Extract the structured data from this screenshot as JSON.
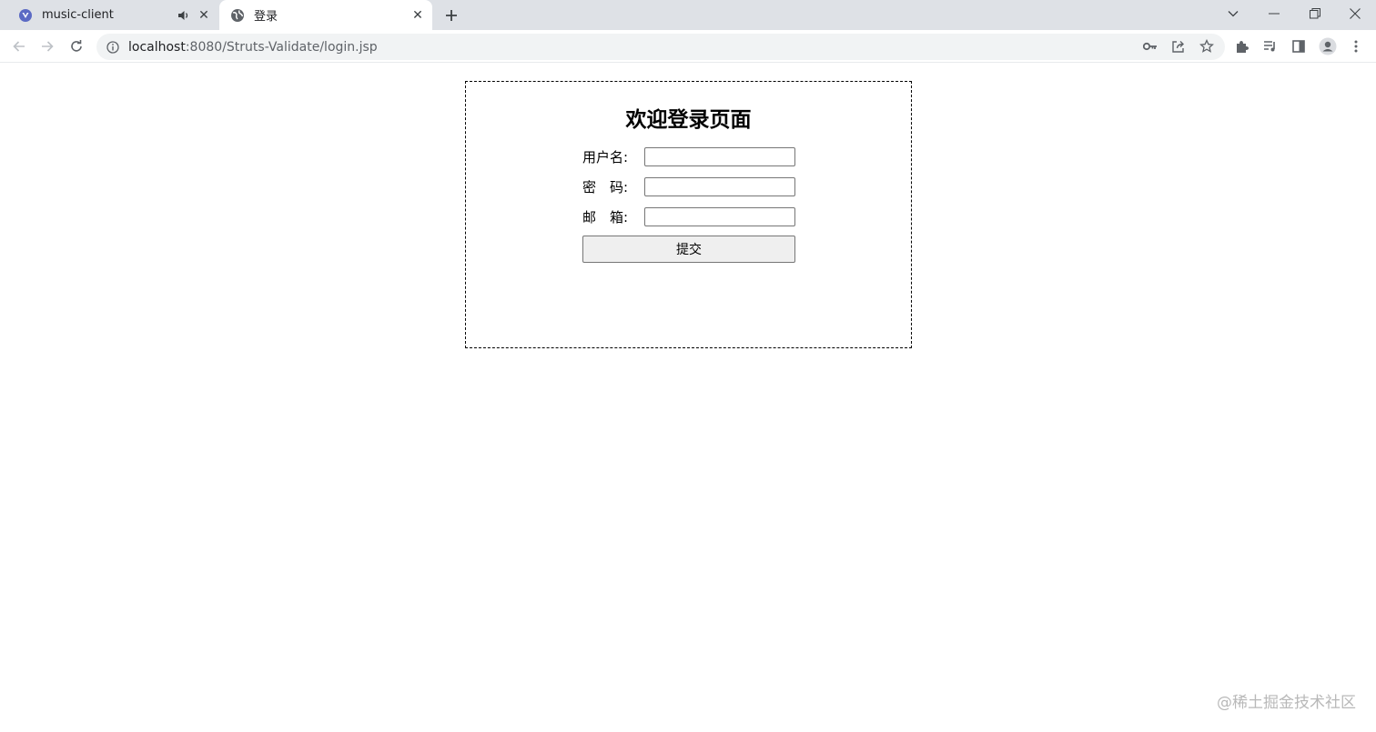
{
  "browser": {
    "tabs": [
      {
        "title": "music-client",
        "favicon": "vue-icon",
        "audio": true,
        "active": false
      },
      {
        "title": "登录",
        "favicon": "globe-icon",
        "active": true
      }
    ],
    "address": {
      "host": "localhost",
      "path": ":8080/Struts-Validate/login.jsp"
    }
  },
  "login": {
    "title": "欢迎登录页面",
    "fields": [
      {
        "label": "用户名:",
        "value": ""
      },
      {
        "label": "密　码:",
        "value": ""
      },
      {
        "label": "邮　箱:",
        "value": ""
      }
    ],
    "submit_label": "提交"
  },
  "watermark": "@稀土掘金技术社区"
}
